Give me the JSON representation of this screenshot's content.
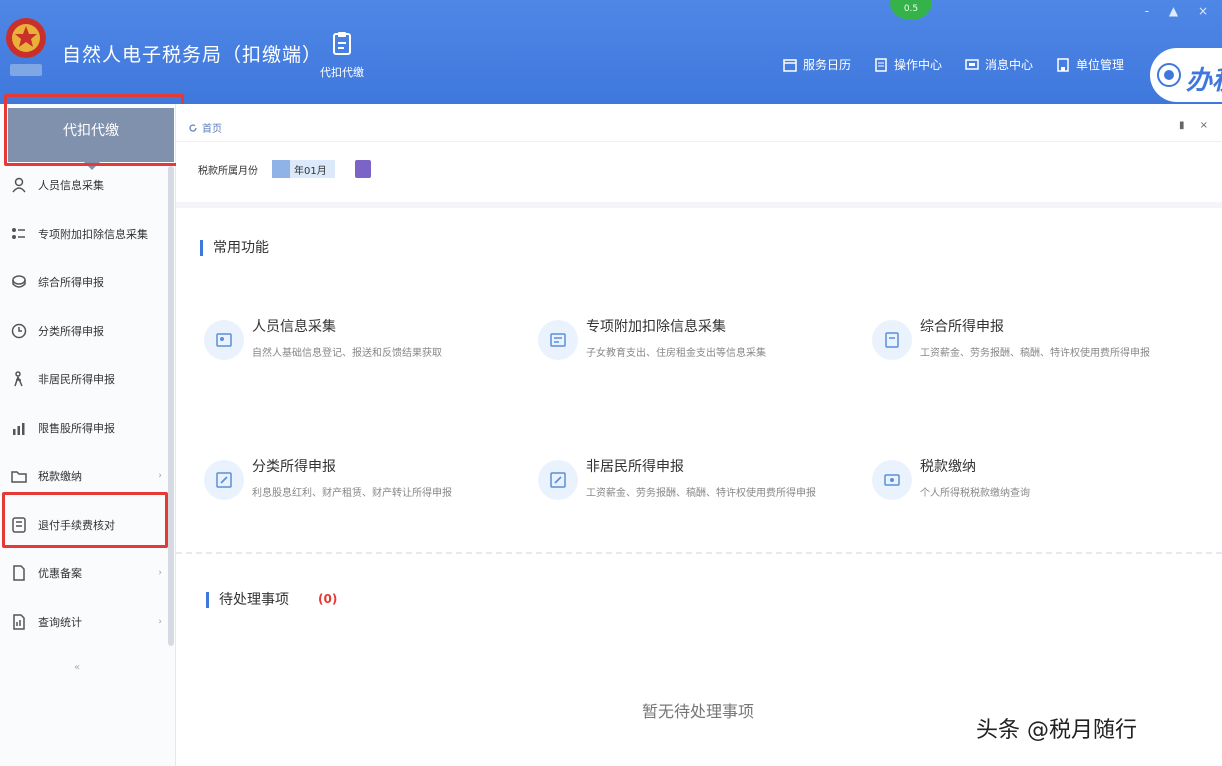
{
  "header": {
    "title": "自然人电子税务局（扣缴端）",
    "module_label": "代扣代缴",
    "status_dot": "0.5",
    "window_controls": "- ▲ ×",
    "nav": [
      {
        "icon": "calendar-icon",
        "label": "服务日历"
      },
      {
        "icon": "document-icon",
        "label": "操作中心"
      },
      {
        "icon": "message-icon",
        "label": "消息中心"
      },
      {
        "icon": "building-icon",
        "label": "单位管理"
      }
    ],
    "office_label": "办税"
  },
  "sidebar": {
    "header": "代扣代缴",
    "items": [
      {
        "icon": "person-icon",
        "label": "人员信息采集",
        "chevron": ""
      },
      {
        "icon": "list-icon",
        "label": "专项附加扣除信息采集",
        "chevron": ""
      },
      {
        "icon": "coin-icon",
        "label": "综合所得申报",
        "chevron": ""
      },
      {
        "icon": "clock-icon",
        "label": "分类所得申报",
        "chevron": ""
      },
      {
        "icon": "person-walk-icon",
        "label": "非居民所得申报",
        "chevron": ""
      },
      {
        "icon": "chart-icon",
        "label": "限售股所得申报",
        "chevron": ""
      },
      {
        "icon": "folder-icon",
        "label": "税款缴纳",
        "chevron": "›"
      },
      {
        "icon": "receipt-icon",
        "label": "退付手续费核对",
        "chevron": ""
      },
      {
        "icon": "file-icon",
        "label": "优惠备案",
        "chevron": "›"
      },
      {
        "icon": "stats-icon",
        "label": "查询统计",
        "chevron": "›"
      }
    ],
    "collapse": "«"
  },
  "main": {
    "home_tab": "首页",
    "tab_controls": "▮ ×",
    "period_label": "税款所属月份",
    "period_value": "年01月",
    "sections": {
      "common": "常用功能",
      "pending": "待处理事项"
    },
    "cards": [
      {
        "icon": "person-card-icon",
        "title": "人员信息采集",
        "desc": "自然人基础信息登记、报送和反馈结果获取"
      },
      {
        "icon": "deduction-icon",
        "title": "专项附加扣除信息采集",
        "desc": "子女教育支出、住房租金支出等信息采集"
      },
      {
        "icon": "report-icon",
        "title": "综合所得申报",
        "desc": "工资薪金、劳务报酬、稿酬、特许权使用费所得申报"
      },
      {
        "icon": "edit-icon",
        "title": "分类所得申报",
        "desc": "利息股息红利、财产租赁、财产转让所得申报"
      },
      {
        "icon": "edit2-icon",
        "title": "非居民所得申报",
        "desc": "工资薪金、劳务报酬、稿酬、特许权使用费所得申报"
      },
      {
        "icon": "payment-icon",
        "title": "税款缴纳",
        "desc": "个人所得税税款缴纳查询"
      }
    ],
    "pending_count": "(0)",
    "empty_text": "暂无待处理事项"
  },
  "watermark": "头条 @税月随行",
  "colors": {
    "header_blue": "#3f78dc",
    "highlight_red": "#e53935",
    "accent_purple": "#7b63c8"
  }
}
